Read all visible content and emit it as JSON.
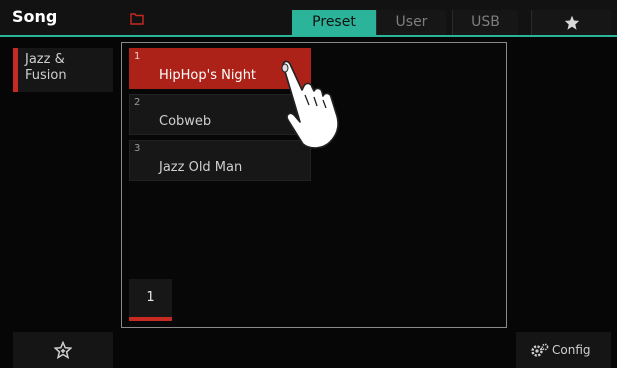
{
  "header": {
    "title": "Song",
    "tabs": [
      {
        "label": "Preset",
        "active": true
      },
      {
        "label": "User",
        "active": false
      },
      {
        "label": "USB",
        "active": false
      },
      {
        "label": "",
        "icon": "star-icon",
        "active": false
      }
    ]
  },
  "category": {
    "label": "Jazz &\nFusion",
    "accent_color": "#c62a22"
  },
  "songs": [
    {
      "number": "1",
      "name": "HipHop's Night",
      "selected": true
    },
    {
      "number": "2",
      "name": "Cobweb",
      "selected": false
    },
    {
      "number": "3",
      "name": "Jazz Old Man",
      "selected": false
    }
  ],
  "pagination": {
    "current_page": "1"
  },
  "footer": {
    "config_label": "Config"
  },
  "colors": {
    "accent_teal": "#2bb49a",
    "selected_red": "#ad2218",
    "background": "#060606"
  }
}
